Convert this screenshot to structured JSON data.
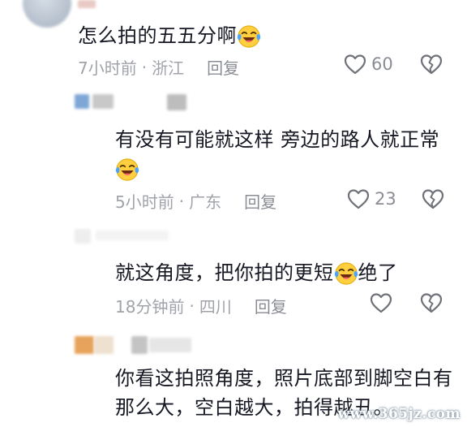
{
  "comments": [
    {
      "text": "怎么拍的五五分啊",
      "time": "7小时前",
      "location": "浙江",
      "reply_label": "回复",
      "likes": "60"
    },
    {
      "text_line1": "有没有可能就这样  旁边的路人就正常",
      "time": "5小时前",
      "location": "广东",
      "reply_label": "回复",
      "likes": "23"
    },
    {
      "text_before_emoji": "就这角度，把你拍的更短",
      "text_after_emoji": "绝了",
      "time": "18分钟前",
      "location": "四川",
      "reply_label": "回复"
    },
    {
      "text_line1": "你看这拍照角度，照片底部到脚空白有",
      "text_line2": "那么大，空白越大，拍得越丑。"
    }
  ],
  "separator": "·",
  "watermark": "www.365jz.com",
  "icons": {
    "emoji": "laughing-crying-emoji-icon",
    "like": "heart-outline-icon",
    "dislike": "broken-heart-icon"
  },
  "colors": {
    "text": "#161823",
    "meta": "#a0a3aa",
    "emoji_face": "#ffcf3f",
    "tears": "#4aa3ff"
  }
}
